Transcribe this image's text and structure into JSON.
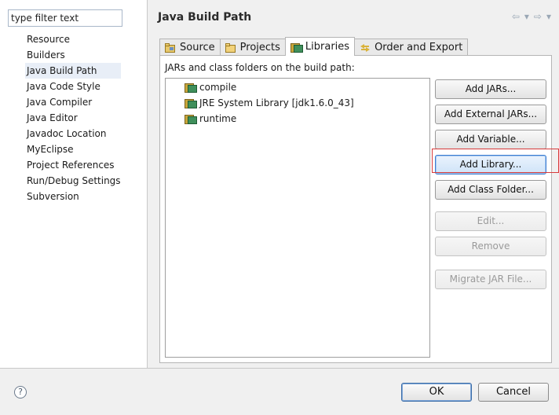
{
  "filter": {
    "placeholder": "type filter text",
    "value": "type filter text"
  },
  "tree": {
    "items": [
      "Resource",
      "Builders",
      "Java Build Path",
      "Java Code Style",
      "Java Compiler",
      "Java Editor",
      "Javadoc Location",
      "MyEclipse",
      "Project References",
      "Run/Debug Settings",
      "Subversion"
    ],
    "selected": "Java Build Path"
  },
  "page": {
    "title": "Java Build Path"
  },
  "tabs": [
    {
      "label": "Source",
      "icon": "source-folder-icon",
      "active": false
    },
    {
      "label": "Projects",
      "icon": "projects-folder-icon",
      "active": false
    },
    {
      "label": "Libraries",
      "icon": "libraries-icon",
      "active": true
    },
    {
      "label": "Order and Export",
      "icon": "order-export-icon",
      "active": false
    }
  ],
  "libraries": {
    "label": "JARs and class folders on the build path:",
    "items": [
      "compile",
      "JRE System Library [jdk1.6.0_43]",
      "runtime"
    ]
  },
  "buttons": {
    "add_jars": "Add JARs...",
    "add_external_jars": "Add External JARs...",
    "add_variable": "Add Variable...",
    "add_library": "Add Library...",
    "add_class_folder": "Add Class Folder...",
    "edit": "Edit...",
    "remove": "Remove",
    "migrate_jar": "Migrate JAR File..."
  },
  "footer": {
    "ok": "OK",
    "cancel": "Cancel",
    "help": "?"
  },
  "colors": {
    "highlight": "#d83b3b",
    "focus": "#3b7cd1"
  }
}
